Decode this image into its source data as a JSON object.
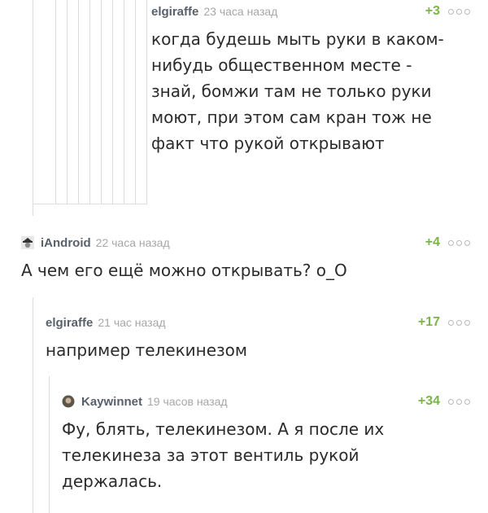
{
  "comments": [
    {
      "author": "elgiraffe",
      "time": "23 часа назад",
      "rating": "+3",
      "text": "когда будешь мыть руки в каком-\nнибудь общественном месте -\nзнай, бомжи там не только руки\nмоют, при этом сам кран тож не\nфакт что рукой открывают"
    },
    {
      "author": "iAndroid",
      "time": "22 часа назад",
      "rating": "+4",
      "avatar_icon": "hat-avatar-icon",
      "text": "А чем его ещё можно открывать? о_О"
    },
    {
      "author": "elgiraffe",
      "time": "21 час назад",
      "rating": "+17",
      "text": "например телекинезом"
    },
    {
      "author": "Kaywinnet",
      "time": "19 часов назад",
      "rating": "+34",
      "avatar_icon": "round-avatar-icon",
      "text": "Фу, блять, телекинезом. А я после их\nтелекинеза за этот вентиль рукой\nдержалась."
    }
  ],
  "colors": {
    "author": "#58616b",
    "time": "#a7a7a7",
    "rating": "#7ab549",
    "text": "#2b2b2b",
    "thread_line": "#dcdcdc"
  }
}
